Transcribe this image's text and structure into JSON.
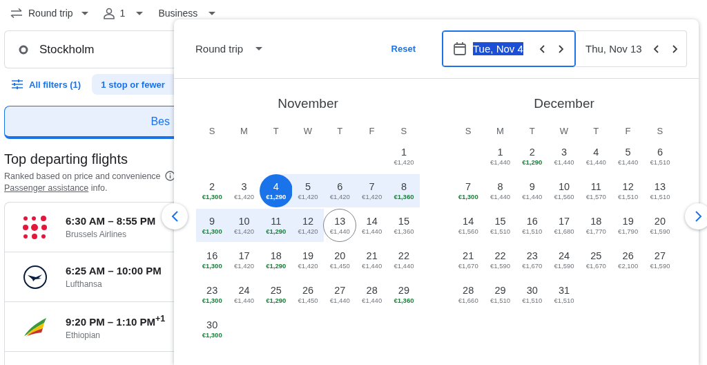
{
  "trip_bar": {
    "trip_type": "Round trip",
    "passengers": "1",
    "cabin": "Business"
  },
  "search": {
    "origin": "Stockholm"
  },
  "filters": [
    {
      "label": "All filters (1)",
      "kind": "filters"
    },
    {
      "label": "1 stop or fewer",
      "kind": "chip"
    }
  ],
  "sort_tabs": [
    {
      "label": "Bes",
      "selected": true
    }
  ],
  "results": {
    "title": "Top departing flights",
    "subtitle": "Ranked based on price and convenience",
    "assistance_link": "Passenger assistance",
    "assistance_rest": "info."
  },
  "flights": [
    {
      "times": "6:30 AM – 8:55 PM",
      "airline": "Brussels Airlines",
      "kind": "dots"
    },
    {
      "times": "6:25 AM – 10:00 PM",
      "airline": "Lufthansa",
      "kind": "crane"
    },
    {
      "times": "9:20 PM – 1:10 PM$^{+1}$",
      "airline": "Ethiopian",
      "kind": "stripes"
    }
  ],
  "date_picker": {
    "trip_type": "Round trip",
    "reset": "Reset",
    "departure": {
      "label": "Tue, Nov 4",
      "focused": true,
      "text_selected": true
    },
    "return": {
      "label": "Thu, Nov 13",
      "focused": false,
      "text_selected": false
    },
    "months": [
      {
        "name": "November",
        "weekdays": [
          "S",
          "M",
          "T",
          "W",
          "T",
          "F",
          "S"
        ],
        "weeks": [
          {
            "kind": "leading",
            "days": [
              {
                "day": "1",
                "price": "€1,420",
                "low": false,
                "in_range": false,
                "kind": "day"
              }
            ]
          },
          {
            "kind": "full",
            "days": [
              {
                "day": "2",
                "price": "€1,300",
                "low": true,
                "in_range": false,
                "kind": "day"
              },
              {
                "day": "3",
                "price": "€1,420",
                "low": false,
                "in_range": false,
                "kind": "day"
              },
              {
                "day": "4",
                "price": "€1,290",
                "low": true,
                "in_range": true,
                "kind": "departure"
              },
              {
                "day": "5",
                "price": "€1,420",
                "low": false,
                "in_range": true,
                "kind": "day"
              },
              {
                "day": "6",
                "price": "€1,420",
                "low": false,
                "in_range": true,
                "kind": "day"
              },
              {
                "day": "7",
                "price": "€1,420",
                "low": false,
                "in_range": true,
                "kind": "day"
              },
              {
                "day": "8",
                "price": "€1,360",
                "low": true,
                "in_range": true,
                "kind": "day"
              }
            ]
          },
          {
            "kind": "full",
            "days": [
              {
                "day": "9",
                "price": "€1,300",
                "low": true,
                "in_range": true,
                "kind": "day"
              },
              {
                "day": "10",
                "price": "€1,420",
                "low": false,
                "in_range": true,
                "kind": "day"
              },
              {
                "day": "11",
                "price": "€1,290",
                "low": true,
                "in_range": true,
                "kind": "day"
              },
              {
                "day": "12",
                "price": "€1,420",
                "low": false,
                "in_range": true,
                "kind": "day"
              },
              {
                "day": "13",
                "price": "€1,440",
                "low": false,
                "in_range": false,
                "kind": "return"
              },
              {
                "day": "14",
                "price": "€1,440",
                "low": false,
                "in_range": false,
                "kind": "day"
              },
              {
                "day": "15",
                "price": "€1,360",
                "low": false,
                "in_range": false,
                "kind": "day"
              }
            ]
          },
          {
            "kind": "full",
            "days": [
              {
                "day": "16",
                "price": "€1,300",
                "low": true,
                "in_range": false,
                "kind": "day"
              },
              {
                "day": "17",
                "price": "€1,420",
                "low": false,
                "in_range": false,
                "kind": "day"
              },
              {
                "day": "18",
                "price": "€1,290",
                "low": true,
                "in_range": false,
                "kind": "day"
              },
              {
                "day": "19",
                "price": "€1,420",
                "low": false,
                "in_range": false,
                "kind": "day"
              },
              {
                "day": "20",
                "price": "€1,450",
                "low": false,
                "in_range": false,
                "kind": "day"
              },
              {
                "day": "21",
                "price": "€1,440",
                "low": false,
                "in_range": false,
                "kind": "day"
              },
              {
                "day": "22",
                "price": "€1,440",
                "low": false,
                "in_range": false,
                "kind": "day"
              }
            ]
          },
          {
            "kind": "full",
            "days": [
              {
                "day": "23",
                "price": "€1,300",
                "low": true,
                "in_range": false,
                "kind": "day"
              },
              {
                "day": "24",
                "price": "€1,440",
                "low": false,
                "in_range": false,
                "kind": "day"
              },
              {
                "day": "25",
                "price": "€1,290",
                "low": true,
                "in_range": false,
                "kind": "day"
              },
              {
                "day": "26",
                "price": "€1,450",
                "low": false,
                "in_range": false,
                "kind": "day"
              },
              {
                "day": "27",
                "price": "€1,440",
                "low": false,
                "in_range": false,
                "kind": "day"
              },
              {
                "day": "28",
                "price": "€1,440",
                "low": false,
                "in_range": false,
                "kind": "day"
              },
              {
                "day": "29",
                "price": "€1,360",
                "low": true,
                "in_range": false,
                "kind": "day"
              }
            ]
          },
          {
            "kind": "trailing",
            "days": [
              {
                "day": "30",
                "price": "€1,300",
                "low": true,
                "in_range": false,
                "kind": "day"
              }
            ]
          }
        ]
      },
      {
        "name": "December",
        "weekdays": [
          "S",
          "M",
          "T",
          "W",
          "T",
          "F",
          "S"
        ],
        "weeks": [
          {
            "kind": "leading",
            "days": [
              {
                "day": "1",
                "price": "€1,440",
                "low": false,
                "in_range": false,
                "kind": "day"
              },
              {
                "day": "2",
                "price": "€1,290",
                "low": true,
                "in_range": false,
                "kind": "day"
              },
              {
                "day": "3",
                "price": "€1,440",
                "low": false,
                "in_range": false,
                "kind": "day"
              },
              {
                "day": "4",
                "price": "€1,440",
                "low": false,
                "in_range": false,
                "kind": "day"
              },
              {
                "day": "5",
                "price": "€1,440",
                "low": false,
                "in_range": false,
                "kind": "day"
              },
              {
                "day": "6",
                "price": "€1,510",
                "low": false,
                "in_range": false,
                "kind": "day"
              }
            ]
          },
          {
            "kind": "full",
            "days": [
              {
                "day": "7",
                "price": "€1,300",
                "low": true,
                "in_range": false,
                "kind": "day"
              },
              {
                "day": "8",
                "price": "€1,440",
                "low": false,
                "in_range": false,
                "kind": "day"
              },
              {
                "day": "9",
                "price": "€1,440",
                "low": false,
                "in_range": false,
                "kind": "day"
              },
              {
                "day": "10",
                "price": "€1,560",
                "low": false,
                "in_range": false,
                "kind": "day"
              },
              {
                "day": "11",
                "price": "€1,570",
                "low": false,
                "in_range": false,
                "kind": "day"
              },
              {
                "day": "12",
                "price": "€1,510",
                "low": false,
                "in_range": false,
                "kind": "day"
              },
              {
                "day": "13",
                "price": "€1,510",
                "low": false,
                "in_range": false,
                "kind": "day"
              }
            ]
          },
          {
            "kind": "full",
            "days": [
              {
                "day": "14",
                "price": "€1,560",
                "low": false,
                "in_range": false,
                "kind": "day"
              },
              {
                "day": "15",
                "price": "€1,510",
                "low": false,
                "in_range": false,
                "kind": "day"
              },
              {
                "day": "16",
                "price": "€1,510",
                "low": false,
                "in_range": false,
                "kind": "day"
              },
              {
                "day": "17",
                "price": "€1,680",
                "low": false,
                "in_range": false,
                "kind": "day"
              },
              {
                "day": "18",
                "price": "€1,770",
                "low": false,
                "in_range": false,
                "kind": "day"
              },
              {
                "day": "19",
                "price": "€1,790",
                "low": false,
                "in_range": false,
                "kind": "day"
              },
              {
                "day": "20",
                "price": "€1,590",
                "low": false,
                "in_range": false,
                "kind": "day"
              }
            ]
          },
          {
            "kind": "full",
            "days": [
              {
                "day": "21",
                "price": "€1,670",
                "low": false,
                "in_range": false,
                "kind": "day"
              },
              {
                "day": "22",
                "price": "€1,590",
                "low": false,
                "in_range": false,
                "kind": "day"
              },
              {
                "day": "23",
                "price": "€1,670",
                "low": false,
                "in_range": false,
                "kind": "day"
              },
              {
                "day": "24",
                "price": "€1,590",
                "low": false,
                "in_range": false,
                "kind": "day"
              },
              {
                "day": "25",
                "price": "€1,670",
                "low": false,
                "in_range": false,
                "kind": "day"
              },
              {
                "day": "26",
                "price": "€2,100",
                "low": false,
                "in_range": false,
                "kind": "day"
              },
              {
                "day": "27",
                "price": "€1,590",
                "low": false,
                "in_range": false,
                "kind": "day"
              }
            ]
          },
          {
            "kind": "trailing",
            "days": [
              {
                "day": "28",
                "price": "€1,660",
                "low": false,
                "in_range": false,
                "kind": "day"
              },
              {
                "day": "29",
                "price": "€1,510",
                "low": false,
                "in_range": false,
                "kind": "day"
              },
              {
                "day": "30",
                "price": "€1,510",
                "low": false,
                "in_range": false,
                "kind": "day"
              },
              {
                "day": "31",
                "price": "€1,510",
                "low": false,
                "in_range": false,
                "kind": "day"
              }
            ]
          }
        ]
      }
    ]
  }
}
